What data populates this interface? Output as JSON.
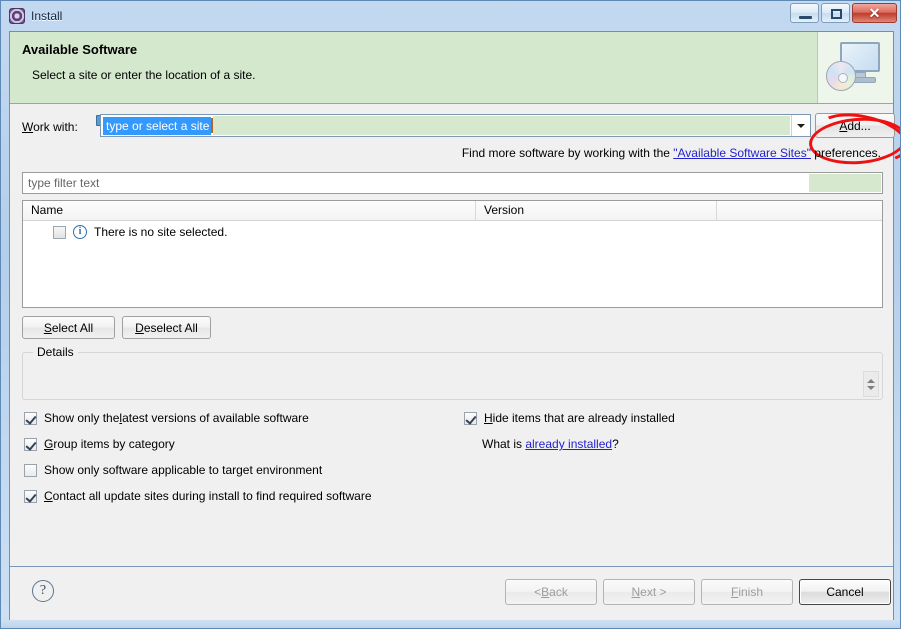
{
  "window": {
    "title": "Install",
    "icon": "install-gear-icon",
    "buttons": {
      "minimize": "–",
      "maximize": "□",
      "close": "✕"
    }
  },
  "banner": {
    "title": "Available Software",
    "subtitle": "Select a site or enter the location of a site.",
    "icon": "monitor-with-disc-icon"
  },
  "work_with": {
    "label_pre": "W",
    "label_post": "ork with:",
    "info_badge": "i",
    "combo_value": "type or select a site",
    "add_button": {
      "pre": "A",
      "post": "dd..."
    },
    "annotation": "red-circle-highlight"
  },
  "find_more": {
    "prefix": "Find more software by working with the ",
    "link": "\"Available Software Sites\"",
    "suffix": " preferences."
  },
  "filter": {
    "placeholder": "type filter text",
    "value": ""
  },
  "table": {
    "columns": [
      "Name",
      "Version",
      ""
    ],
    "rows": [
      {
        "checked": false,
        "icon": "info-icon",
        "label": "There is no site selected."
      }
    ]
  },
  "buttons": {
    "select_all": {
      "pre": "S",
      "post": "elect All"
    },
    "deselect_all": {
      "pre": "D",
      "post": "eselect All"
    }
  },
  "details": {
    "legend": "Details",
    "text": ""
  },
  "options": [
    {
      "checked": true,
      "pre": "Show only the ",
      "mn": "l",
      "post": "atest versions of available software"
    },
    {
      "checked": true,
      "pre": "",
      "mn": "G",
      "post": "roup items by category"
    },
    {
      "checked": false,
      "pre": "",
      "mn": "S",
      "post": "how only software applicable to target environment"
    },
    {
      "checked": true,
      "pre": "",
      "mn": "C",
      "post": "ontact all update sites during install to find required software"
    },
    {
      "checked": true,
      "pre": "",
      "mn": "H",
      "post": "ide items that are already installed"
    }
  ],
  "what_is": {
    "prefix": "What is ",
    "link": "already installed",
    "suffix": "?"
  },
  "footer": {
    "help": "?",
    "back": {
      "pre": "< ",
      "mn": "B",
      "post": "ack"
    },
    "next": {
      "pre": "",
      "mn": "N",
      "post": "ext >"
    },
    "finish": {
      "pre": "",
      "mn": "F",
      "post": "inish"
    },
    "cancel": {
      "pre": "",
      "mn": "",
      "post": "Cancel"
    }
  },
  "colors": {
    "banner_bg": "#d4e8cd",
    "selection": "#3399ff",
    "link": "#2222cc",
    "annotation": "#ee1111",
    "green_tint": "#d6e9cf"
  }
}
